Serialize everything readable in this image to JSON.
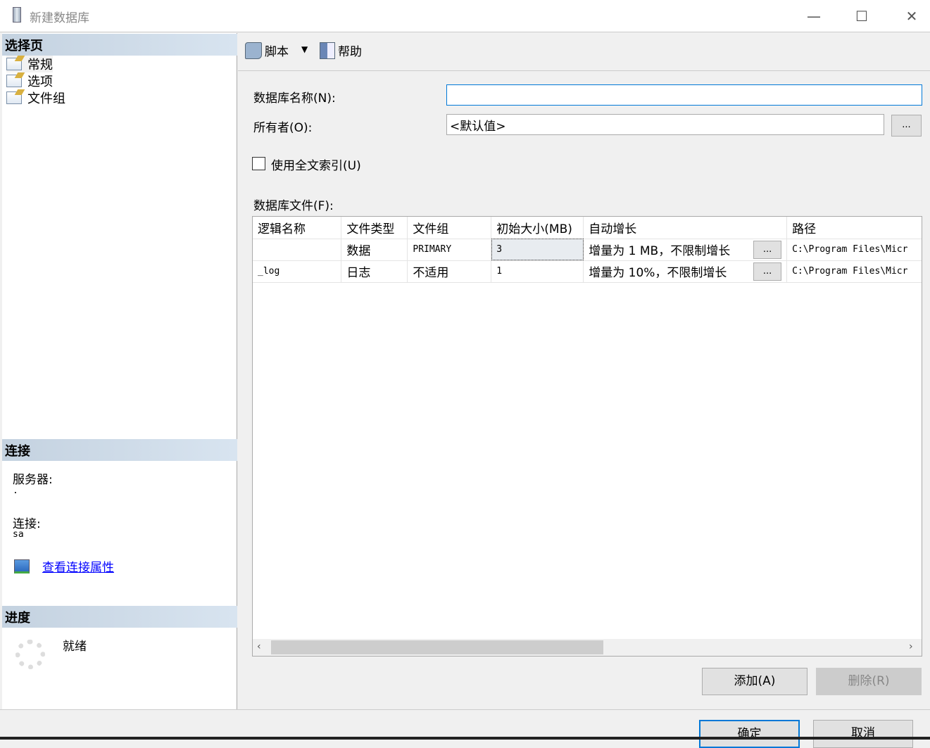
{
  "window": {
    "title": "新建数据库",
    "minimize": "—",
    "maximize": "☐",
    "close": "✕"
  },
  "left": {
    "select_page_header": "选择页",
    "pages": [
      {
        "label": "常规"
      },
      {
        "label": "选项"
      },
      {
        "label": "文件组"
      }
    ],
    "connection_header": "连接",
    "server_label": "服务器:",
    "server_value": ".",
    "connection_label": "连接:",
    "connection_value": "sa",
    "view_props_link": "查看连接属性",
    "progress_header": "进度",
    "progress_status": "就绪"
  },
  "toolbar": {
    "script_label": "脚本",
    "help_label": "帮助"
  },
  "form": {
    "db_name_label": "数据库名称(N):",
    "db_name_value": "",
    "owner_label": "所有者(O):",
    "owner_value": "<默认值>",
    "browse": "...",
    "fulltext_label": "使用全文索引(U)",
    "fulltext_checked": false,
    "files_label": "数据库文件(F):"
  },
  "grid": {
    "columns": [
      "逻辑名称",
      "文件类型",
      "文件组",
      "初始大小(MB)",
      "自动增长",
      "路径"
    ],
    "rows": [
      {
        "name": "",
        "type": "数据",
        "group": "PRIMARY",
        "size": "3",
        "growth": "增量为 1 MB，不限制增长",
        "path": "C:\\Program Files\\Micr"
      },
      {
        "name": "_log",
        "type": "日志",
        "group": "不适用",
        "size": "1",
        "growth": "增量为 10%，不限制增长",
        "path": "C:\\Program Files\\Micr"
      }
    ],
    "ellipsis": "..."
  },
  "buttons": {
    "add": "添加(A)",
    "remove": "删除(R)",
    "ok": "确定",
    "cancel": "取消"
  }
}
